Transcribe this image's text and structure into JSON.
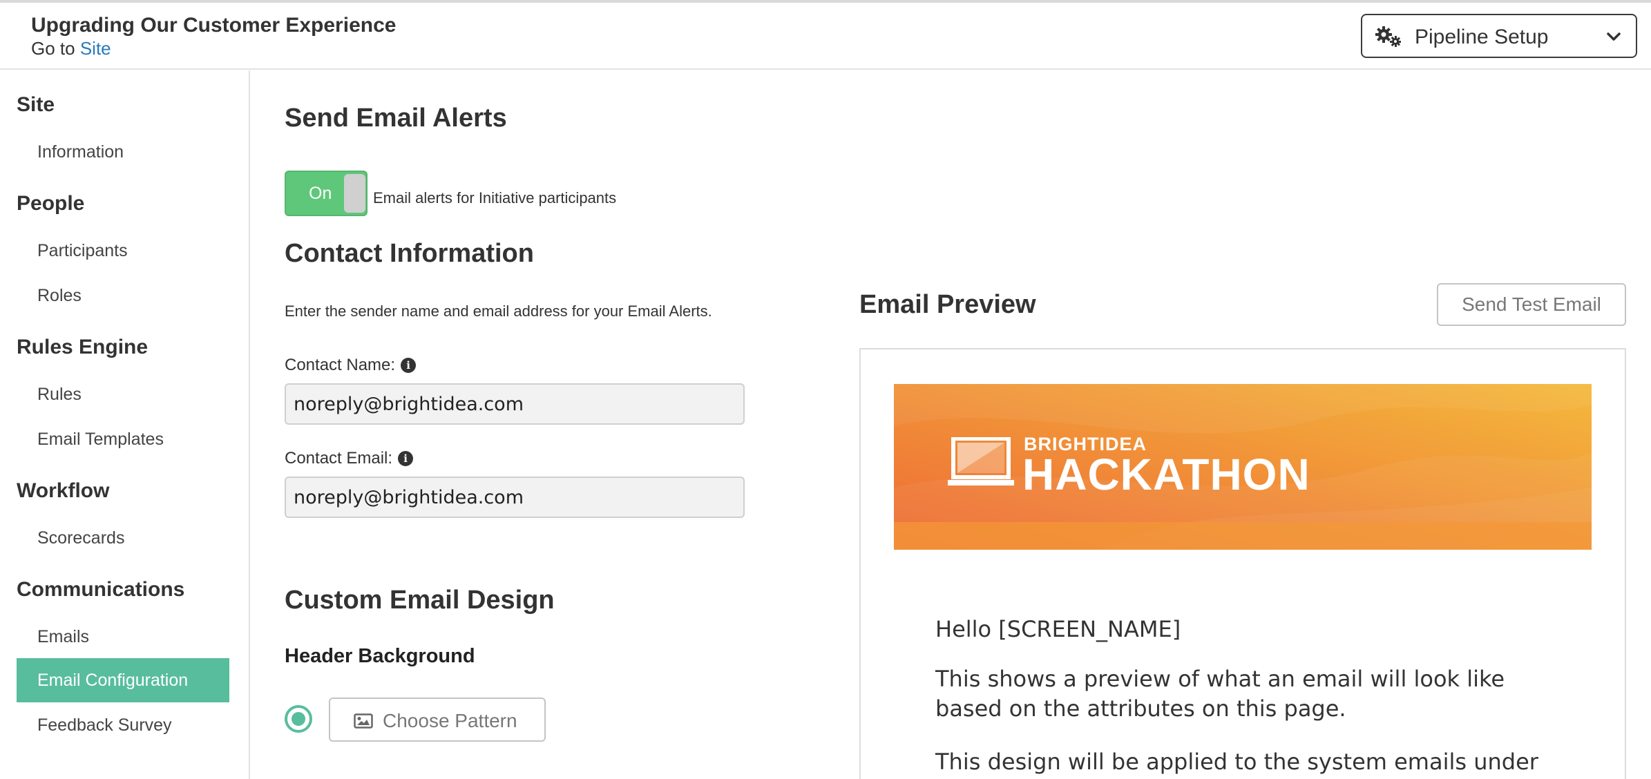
{
  "header": {
    "site_title": "Upgrading Our Customer Experience",
    "goto_prefix": "Go to",
    "goto_link": "Site",
    "menu": {
      "icon": "gears-icon",
      "label": "Pipeline Setup",
      "chevron": "chevron-down-icon"
    }
  },
  "sidebar": {
    "sections": [
      {
        "heading": "Site",
        "items": [
          "Information"
        ]
      },
      {
        "heading": "People",
        "items": [
          "Participants",
          "Roles"
        ]
      },
      {
        "heading": "Rules Engine",
        "items": [
          "Rules",
          "Email Templates"
        ]
      },
      {
        "heading": "Workflow",
        "items": [
          "Scorecards"
        ]
      },
      {
        "heading": "Communications",
        "items": [
          "Emails",
          "Email Configuration",
          "Feedback Survey"
        ]
      }
    ],
    "active_item": "Email Configuration",
    "active_color": "#58bd9d"
  },
  "main": {
    "alerts": {
      "title": "Send Email Alerts",
      "toggle_label": "On",
      "toggle_state": true,
      "toggle_description": "Email alerts for Initiative participants"
    },
    "contact": {
      "title": "Contact Information",
      "description": "Enter the sender name and email address for your Email Alerts.",
      "name_label": "Contact Name:",
      "name_value": "noreply@brightidea.com",
      "email_label": "Contact Email:",
      "email_value": "noreply@brightidea.com"
    },
    "design": {
      "title": "Custom Email Design",
      "subtitle": "Header Background",
      "choose_pattern": "Choose Pattern"
    }
  },
  "preview": {
    "title": "Email Preview",
    "send_test": "Send Test Email",
    "brand_small": "BRIGHTIDEA",
    "brand_big": "HACKATHON",
    "greeting": "Hello [SCREEN_NAME]",
    "paragraph1": "This shows a preview of what an email will look like based on the attributes on this page.",
    "paragraph2": "This design will be applied to the system emails under",
    "banner_colors": [
      "#ee6a35",
      "#f4b93c"
    ]
  }
}
